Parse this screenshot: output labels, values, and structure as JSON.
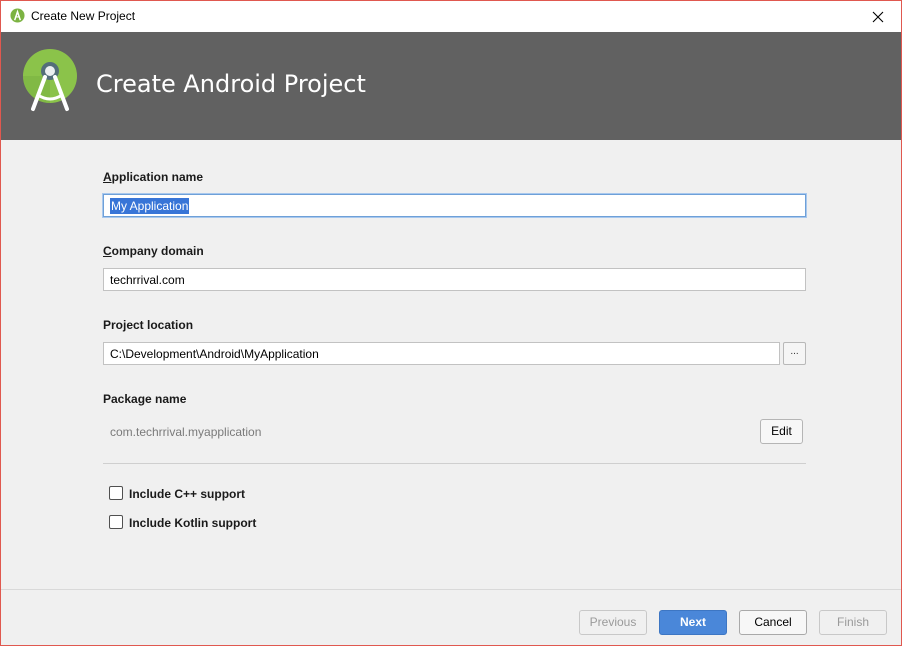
{
  "window": {
    "title": "Create New Project"
  },
  "header": {
    "title": "Create Android Project"
  },
  "form": {
    "app_name": {
      "label_first": "A",
      "label_rest": "pplication name",
      "value": "My Application"
    },
    "company_domain": {
      "label_first": "C",
      "label_rest": "ompany domain",
      "value": "techrrival.com"
    },
    "project_location": {
      "label": "Project location",
      "value": "C:\\Development\\Android\\MyApplication",
      "browse_label": "..."
    },
    "package_name": {
      "label": "Package name",
      "value": "com.techrrival.myapplication",
      "edit_label": "Edit"
    },
    "options": [
      {
        "label": "Include C++ support",
        "checked": false
      },
      {
        "label": "Include Kotlin support",
        "checked": false
      }
    ]
  },
  "footer": {
    "previous_label": "Previous",
    "next_label": "Next",
    "cancel_label": "Cancel",
    "finish_label": "Finish"
  },
  "icons": {
    "app": "android-studio-icon",
    "logo": "android-studio-logo",
    "close": "close-icon"
  },
  "colors": {
    "banner": "#616161",
    "primary": "#4a87d9",
    "selection": "#3875d7",
    "logo_green": "#7cb342"
  }
}
